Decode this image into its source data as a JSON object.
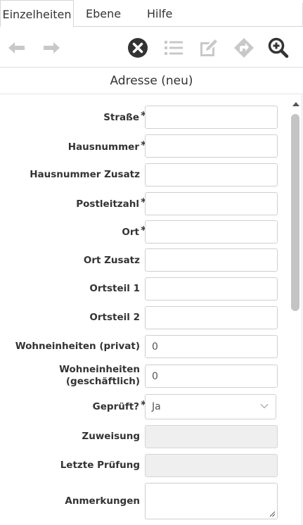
{
  "tabs": [
    {
      "label": "Einzelheiten"
    },
    {
      "label": "Ebene"
    },
    {
      "label": "Hilfe"
    }
  ],
  "toolbar": {
    "buttons": [
      {
        "icon": "arrow-left-icon"
      },
      {
        "icon": "arrow-right-icon"
      },
      {
        "icon": "close-circle-icon"
      },
      {
        "icon": "list-icon"
      },
      {
        "icon": "edit-icon"
      },
      {
        "icon": "forward-icon"
      },
      {
        "icon": "zoom-in-icon"
      }
    ]
  },
  "form": {
    "title": "Adresse (neu)",
    "required_marker": "*",
    "fields": {
      "strasse": {
        "label": "Straße",
        "value": ""
      },
      "hausnummer": {
        "label": "Hausnummer",
        "value": ""
      },
      "hausnummer_zusatz": {
        "label": "Hausnummer Zusatz",
        "value": ""
      },
      "postleitzahl": {
        "label": "Postleitzahl",
        "value": ""
      },
      "ort": {
        "label": "Ort",
        "value": ""
      },
      "ort_zusatz": {
        "label": "Ort Zusatz",
        "value": ""
      },
      "ortsteil1": {
        "label": "Ortsteil 1",
        "value": ""
      },
      "ortsteil2": {
        "label": "Ortsteil 2",
        "value": ""
      },
      "we_privat": {
        "label": "Wohneinheiten (privat)",
        "value": "0"
      },
      "we_geschaeftlich": {
        "label_line1": "Wohneinheiten",
        "label_line2": "(geschäftlich)",
        "value": "0"
      },
      "geprueft": {
        "label": "Geprüft?",
        "value": "Ja"
      },
      "zuweisung": {
        "label": "Zuweisung",
        "value": ""
      },
      "letzte_pruefung": {
        "label": "Letzte Prüfung",
        "value": ""
      },
      "anmerkungen": {
        "label": "Anmerkungen",
        "value": ""
      }
    }
  },
  "colors": {
    "icon_active": "#333333",
    "icon_disabled": "#c8c8c8",
    "disabled_field": "#efefef"
  }
}
